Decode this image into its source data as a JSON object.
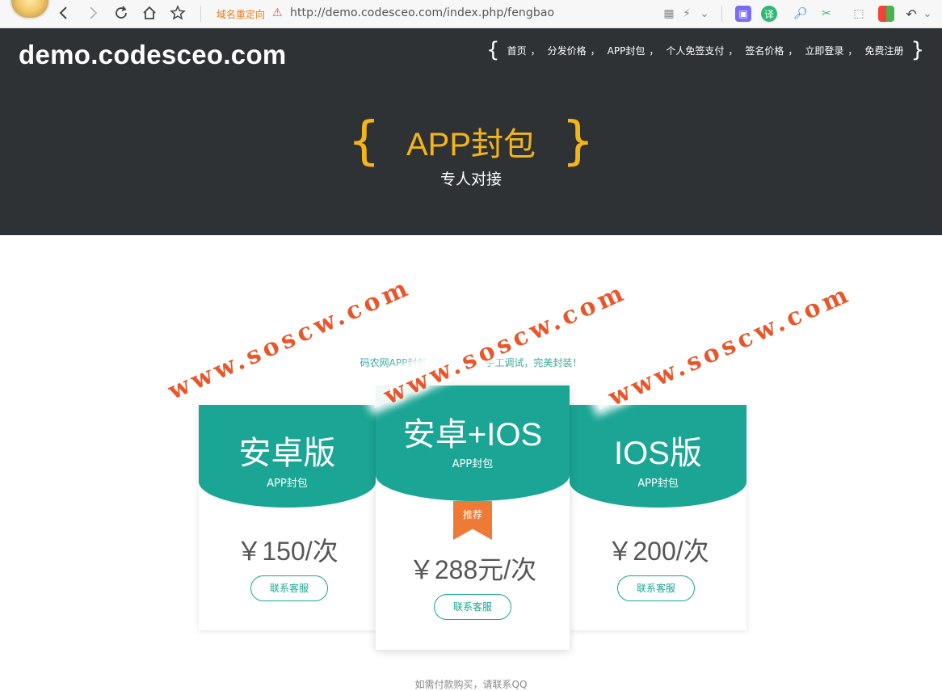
{
  "browser": {
    "redirect_label": "域名重定向",
    "url": "http://demo.codesceo.com/index.php/fengbao",
    "icons": [
      "back-icon",
      "forward-icon",
      "reload-icon",
      "home-icon",
      "star-icon"
    ]
  },
  "site": {
    "logo": "demo.codesceo.com",
    "nav": [
      {
        "label": "首页"
      },
      {
        "label": "分发价格"
      },
      {
        "label": "APP封包"
      },
      {
        "label": "个人免签支付"
      },
      {
        "label": "签名价格"
      },
      {
        "label": "立即登录"
      },
      {
        "label": "免费注册"
      }
    ],
    "nav_separator": "，",
    "brace_open": "{",
    "brace_close": "}"
  },
  "hero": {
    "brace_open": "{",
    "title": "APP封包",
    "brace_close": "}",
    "subtitle": "专人对接"
  },
  "pricing": {
    "intro": "码农网APP封包，专人对接，手工调试，完美封装！",
    "cards": [
      {
        "name": "安卓版",
        "tag": "APP封包",
        "price": "￥150/次",
        "button": "联系客服"
      },
      {
        "name": "安卓+IOS",
        "tag": "APP封包",
        "price": "￥288元/次",
        "button": "联系客服",
        "ribbon": "推荐"
      },
      {
        "name": "IOS版",
        "tag": "APP封包",
        "price": "￥200/次",
        "button": "联系客服"
      }
    ]
  },
  "watermark": "www.soscw.com",
  "footer_partial": "如需付款购买，请联系QQ",
  "colors": {
    "header_bg": "#2e3234",
    "accent_gold": "#f4b41a",
    "teal": "#1ba594",
    "ribbon": "#ee7a35",
    "watermark": "#e8562b"
  }
}
